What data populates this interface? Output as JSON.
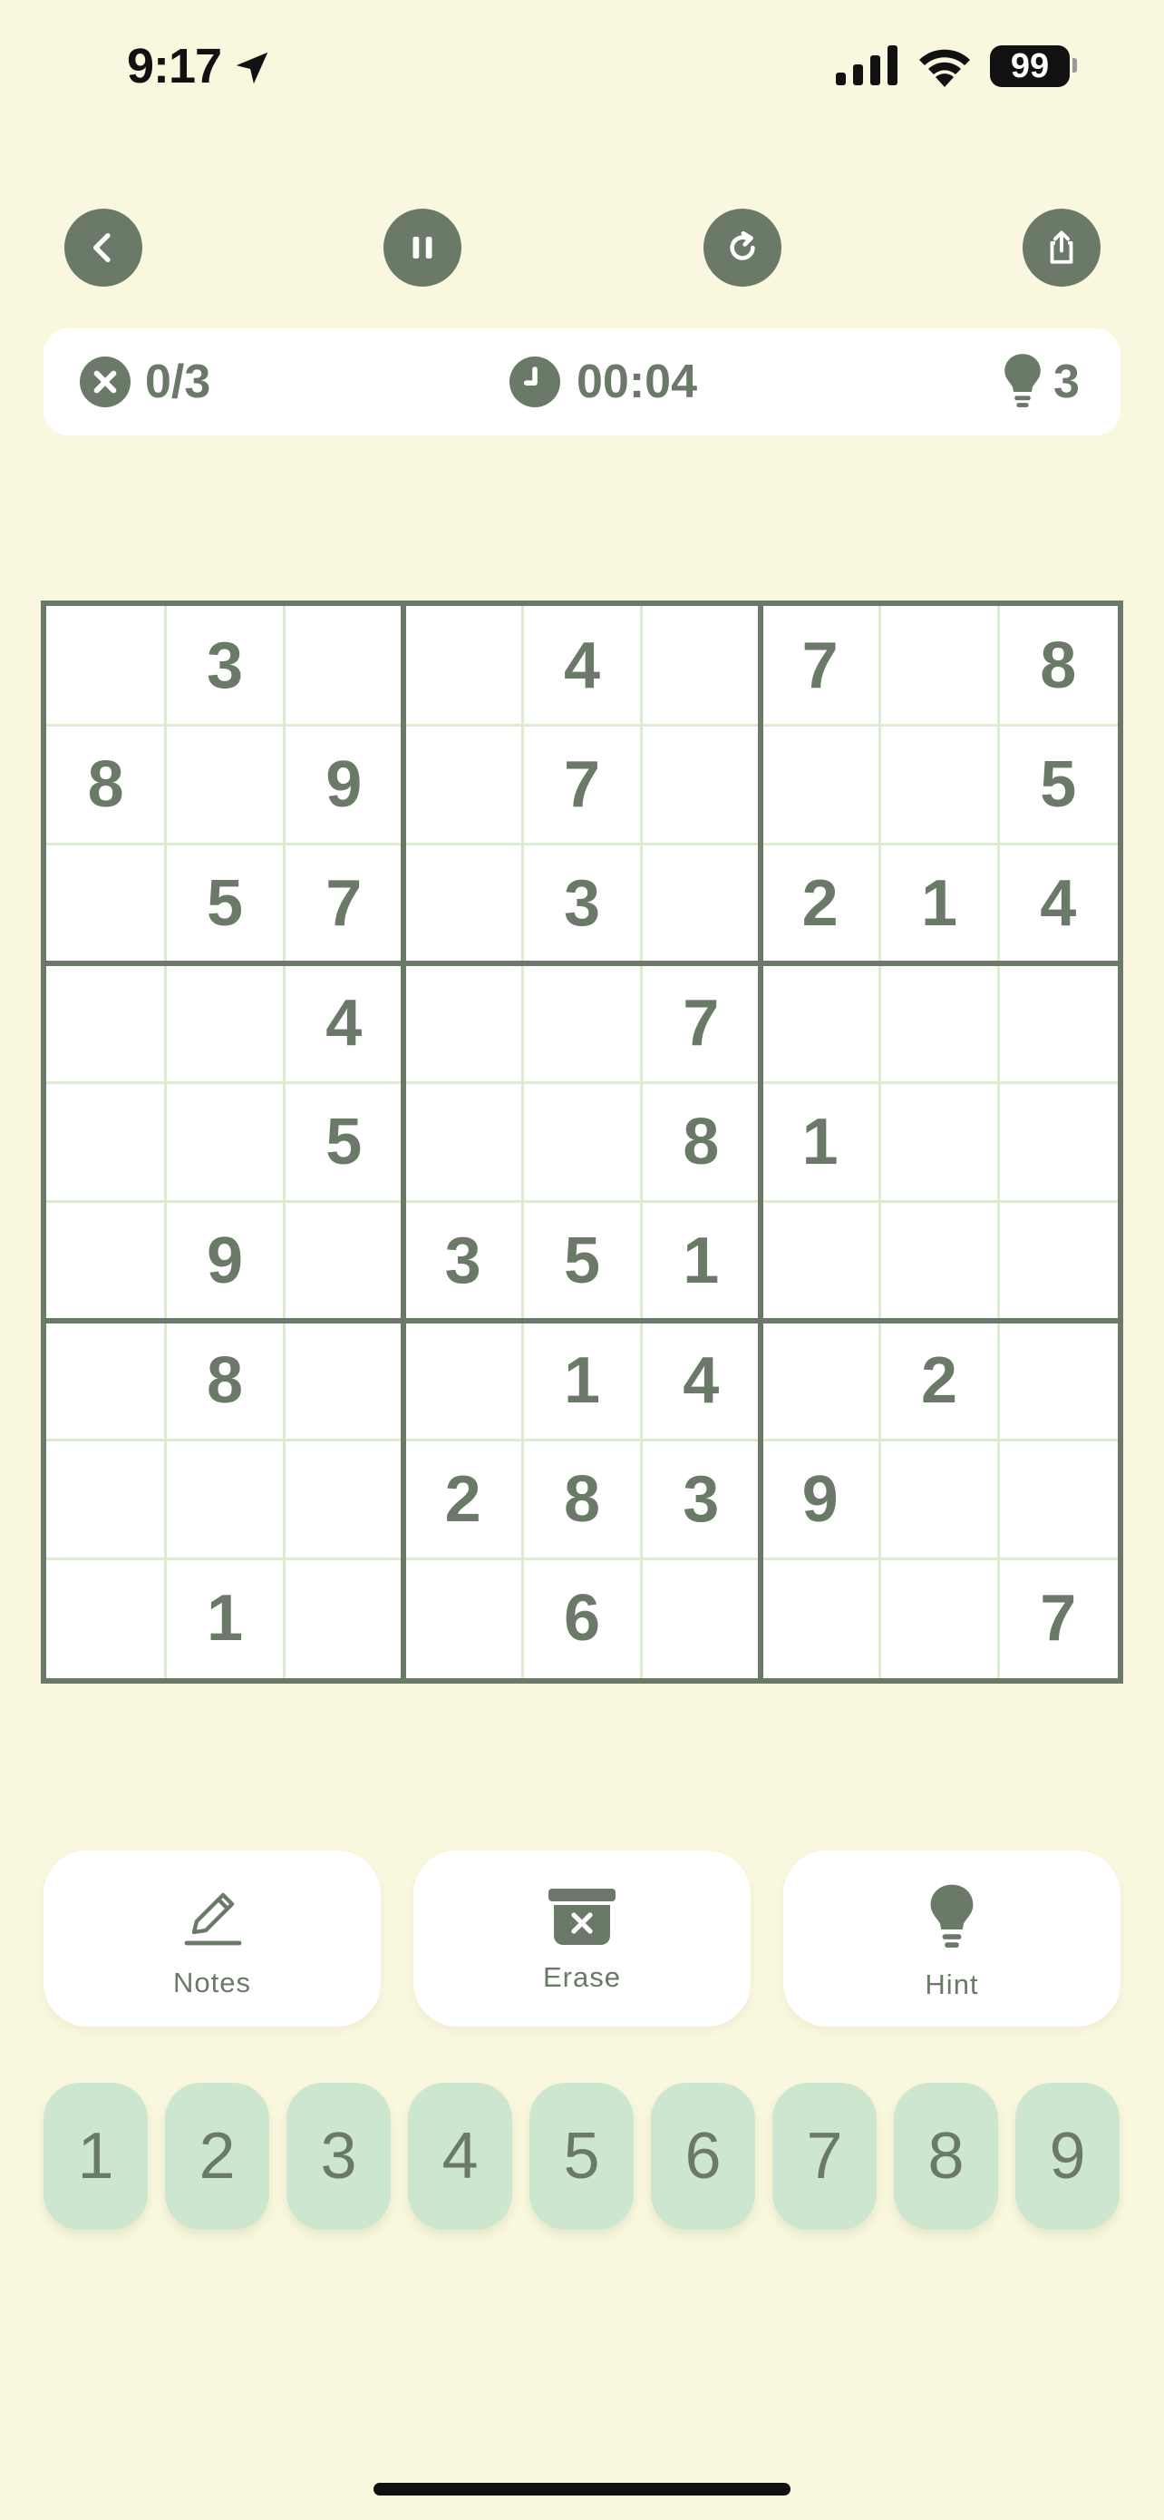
{
  "status_bar": {
    "time": "9:17",
    "battery": "99"
  },
  "toolbar": {
    "back_icon": "chevron-left-icon",
    "pause_icon": "pause-icon",
    "restart_icon": "refresh-icon",
    "share_icon": "share-icon"
  },
  "info": {
    "mistakes": "0/3",
    "timer": "00:04",
    "hints": "3"
  },
  "board": {
    "rows": [
      [
        "",
        "3",
        "",
        "",
        "4",
        "",
        "7",
        "",
        "8"
      ],
      [
        "8",
        "",
        "9",
        "",
        "7",
        "",
        "",
        "",
        "5"
      ],
      [
        "",
        "5",
        "7",
        "",
        "3",
        "",
        "2",
        "1",
        "4"
      ],
      [
        "",
        "",
        "4",
        "",
        "",
        "7",
        "",
        "",
        ""
      ],
      [
        "",
        "",
        "5",
        "",
        "",
        "8",
        "1",
        "",
        ""
      ],
      [
        "",
        "9",
        "",
        "3",
        "5",
        "1",
        "",
        "",
        ""
      ],
      [
        "",
        "8",
        "",
        "",
        "1",
        "4",
        "",
        "2",
        ""
      ],
      [
        "",
        "",
        "",
        "2",
        "8",
        "3",
        "9",
        "",
        ""
      ],
      [
        "",
        "1",
        "",
        "",
        "6",
        "",
        "",
        "",
        "7"
      ]
    ]
  },
  "tools": {
    "notes": "Notes",
    "erase": "Erase",
    "hint": "Hint"
  },
  "numbers": [
    "1",
    "2",
    "3",
    "4",
    "5",
    "6",
    "7",
    "8",
    "9"
  ],
  "colors": {
    "background": "#f9f7dd",
    "accent": "#6b7a68",
    "number_pad": "#cde6cf",
    "grid_thin": "#dbecd0"
  }
}
